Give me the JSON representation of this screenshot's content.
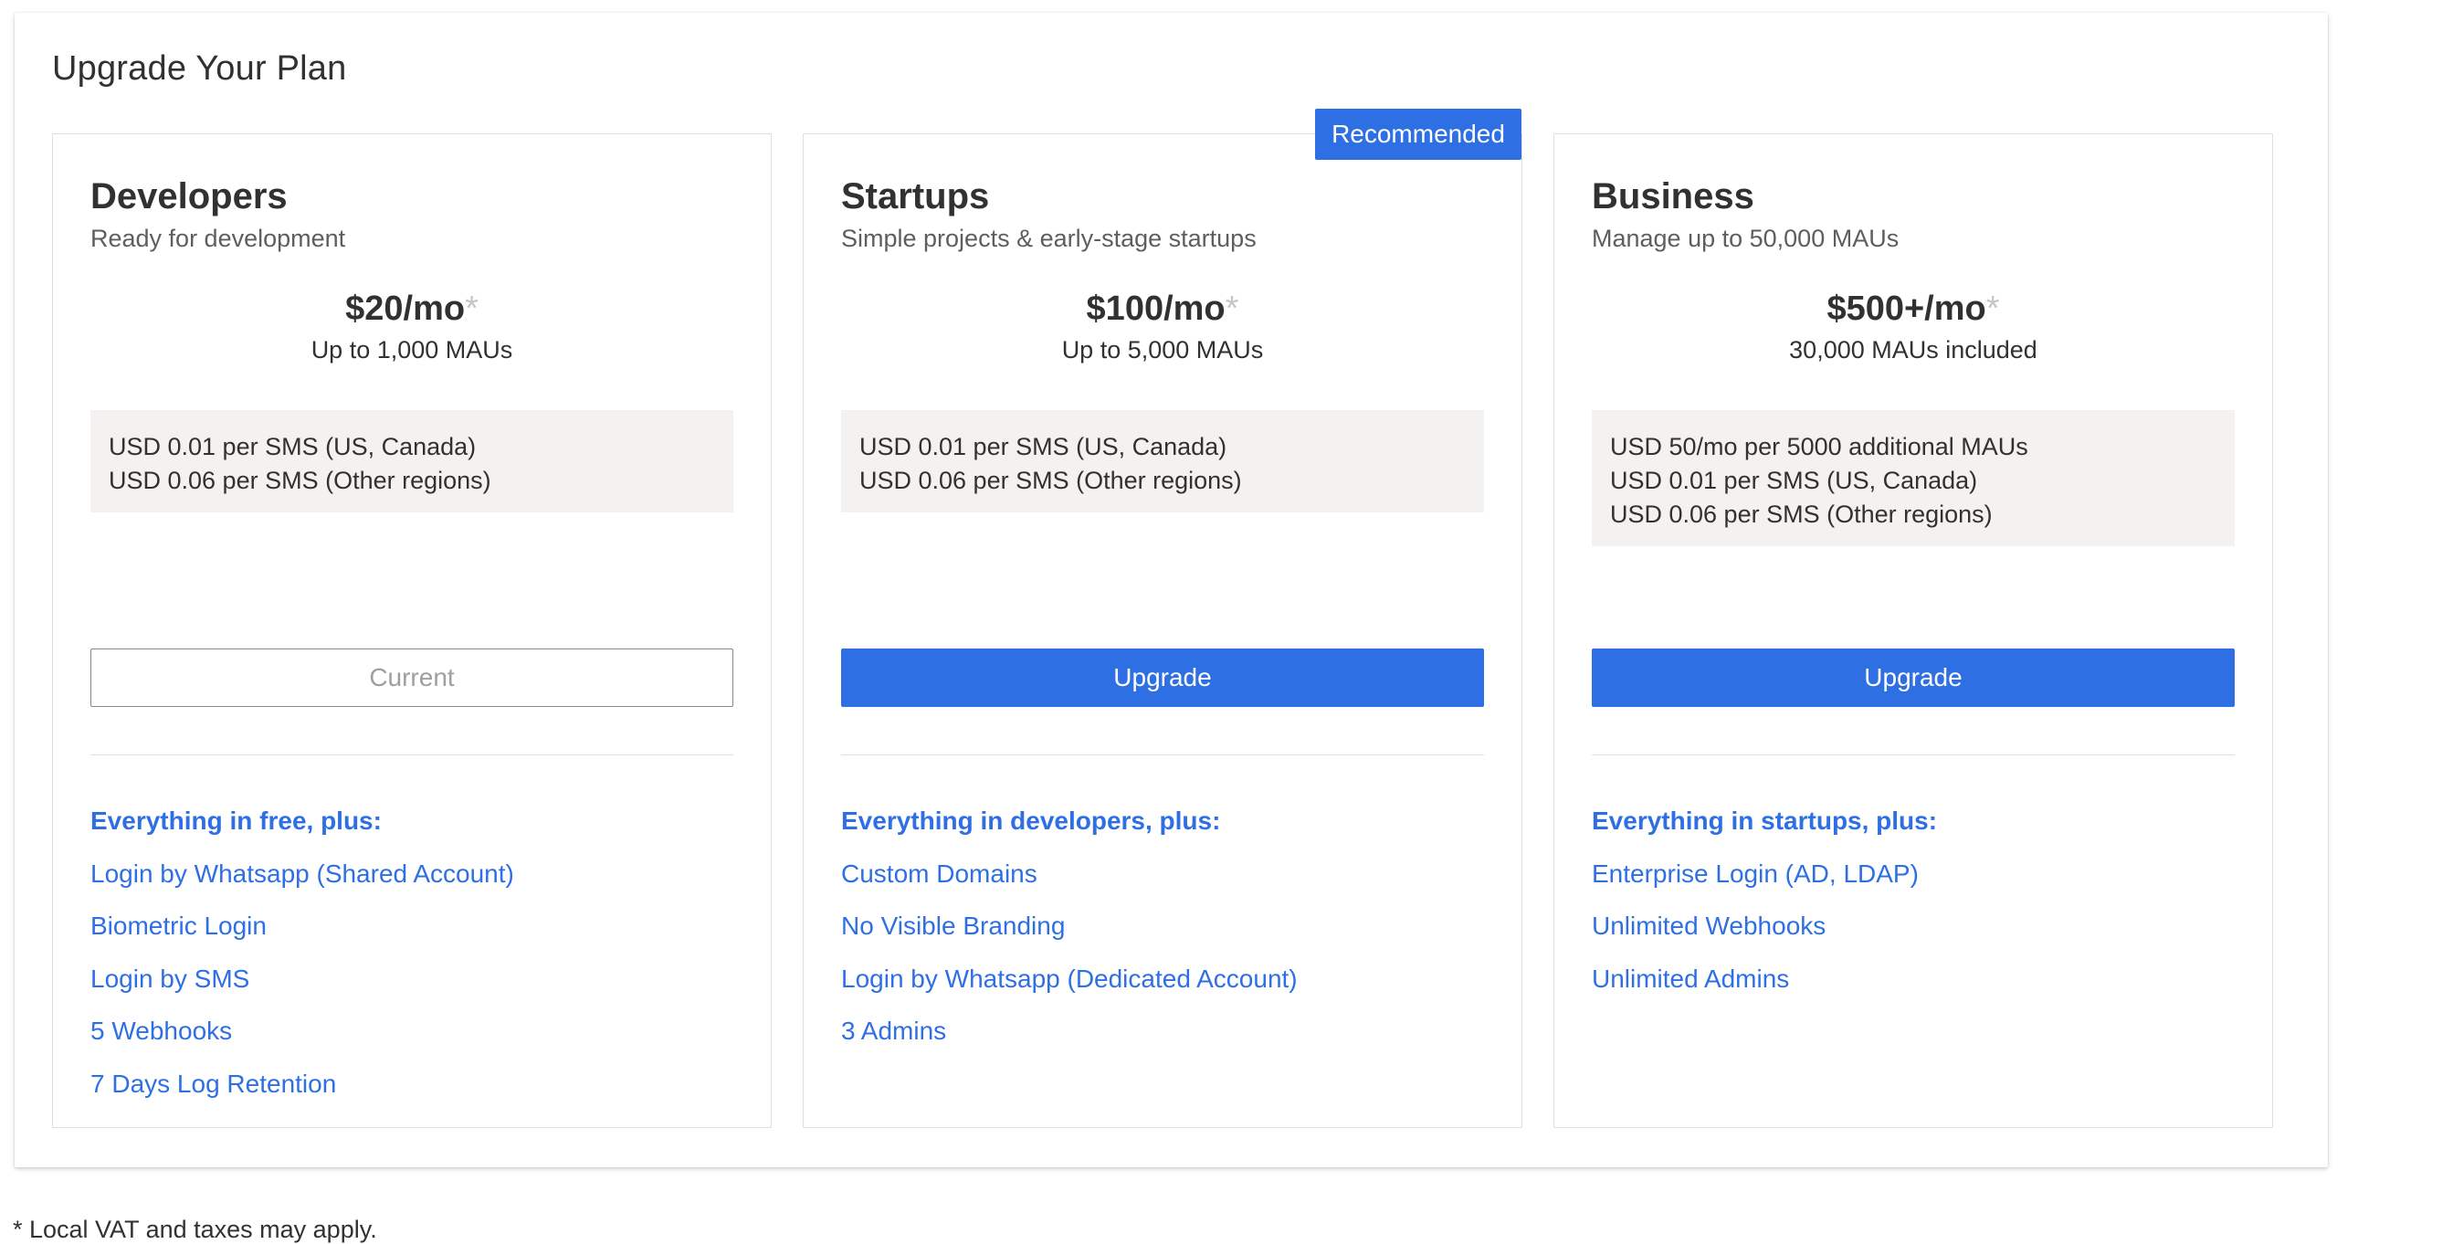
{
  "page": {
    "title": "Upgrade Your Plan",
    "footnote": "* Local VAT and taxes may apply."
  },
  "colors": {
    "accent": "#2f6fe4",
    "note_background": "#f3f2f1",
    "asterisk": "#c8c6c4"
  },
  "plans": [
    {
      "name": "Developers",
      "description": "Ready for development",
      "price": "$20/mo",
      "price_asterisk": "*",
      "price_sub": "Up to 1,000 MAUs",
      "notes": [
        "USD 0.01 per SMS (US, Canada)",
        "USD 0.06 per SMS (Other regions)"
      ],
      "button_label": "Current",
      "button_state": "current",
      "features_header": "Everything in free, plus:",
      "features": [
        "Login by Whatsapp (Shared Account)",
        "Biometric Login",
        "Login by SMS",
        "5 Webhooks",
        "7 Days Log Retention"
      ]
    },
    {
      "name": "Startups",
      "description": "Simple projects & early-stage startups",
      "badge": "Recommended",
      "price": "$100/mo",
      "price_asterisk": "*",
      "price_sub": "Up to 5,000 MAUs",
      "notes": [
        "USD 0.01 per SMS (US, Canada)",
        "USD 0.06 per SMS (Other regions)"
      ],
      "button_label": "Upgrade",
      "button_state": "upgrade",
      "features_header": "Everything in developers, plus:",
      "features": [
        "Custom Domains",
        "No Visible Branding",
        "Login by Whatsapp (Dedicated Account)",
        "3 Admins"
      ]
    },
    {
      "name": "Business",
      "description": "Manage up to 50,000 MAUs",
      "price": "$500+/mo",
      "price_asterisk": "*",
      "price_sub": "30,000 MAUs included",
      "notes": [
        "USD 50/mo per 5000 additional MAUs",
        "USD 0.01 per SMS (US, Canada)",
        "USD 0.06 per SMS (Other regions)"
      ],
      "button_label": "Upgrade",
      "button_state": "upgrade",
      "features_header": "Everything in startups, plus:",
      "features": [
        "Enterprise Login (AD, LDAP)",
        "Unlimited Webhooks",
        "Unlimited Admins"
      ]
    }
  ]
}
